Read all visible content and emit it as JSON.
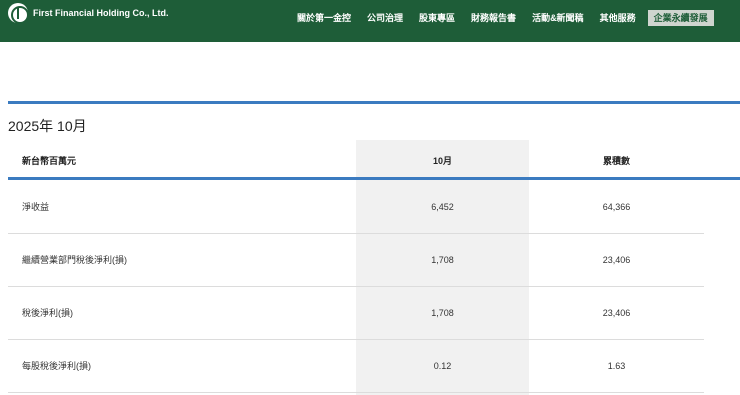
{
  "header": {
    "brand": "First Financial Holding Co., Ltd.",
    "logo_icon": "circle-emblem-icon",
    "background_color": "#1e5d38"
  },
  "nav": {
    "items": [
      {
        "label": "關於第一金控"
      },
      {
        "label": "公司治理"
      },
      {
        "label": "股東專區"
      },
      {
        "label": "財務報告書"
      },
      {
        "label": "活動&新聞稿"
      },
      {
        "label": "其他服務"
      },
      {
        "label": "企業永續發展",
        "active": true
      }
    ]
  },
  "report": {
    "period": "2025年 10月",
    "accent_color": "#3b7bc0",
    "columns": {
      "label": "新台幣百萬元",
      "month": "10月",
      "cumulative": "累積數"
    },
    "rows": [
      {
        "label": "淨收益",
        "month": "6,452",
        "cumulative": "64,366"
      },
      {
        "label": "繼續營業部門稅後淨利(損)",
        "month": "1,708",
        "cumulative": "23,406"
      },
      {
        "label": "稅後淨利(損)",
        "month": "1,708",
        "cumulative": "23,406"
      },
      {
        "label": "每股稅後淨利(損)",
        "month": "0.12",
        "cumulative": "1.63"
      }
    ]
  }
}
